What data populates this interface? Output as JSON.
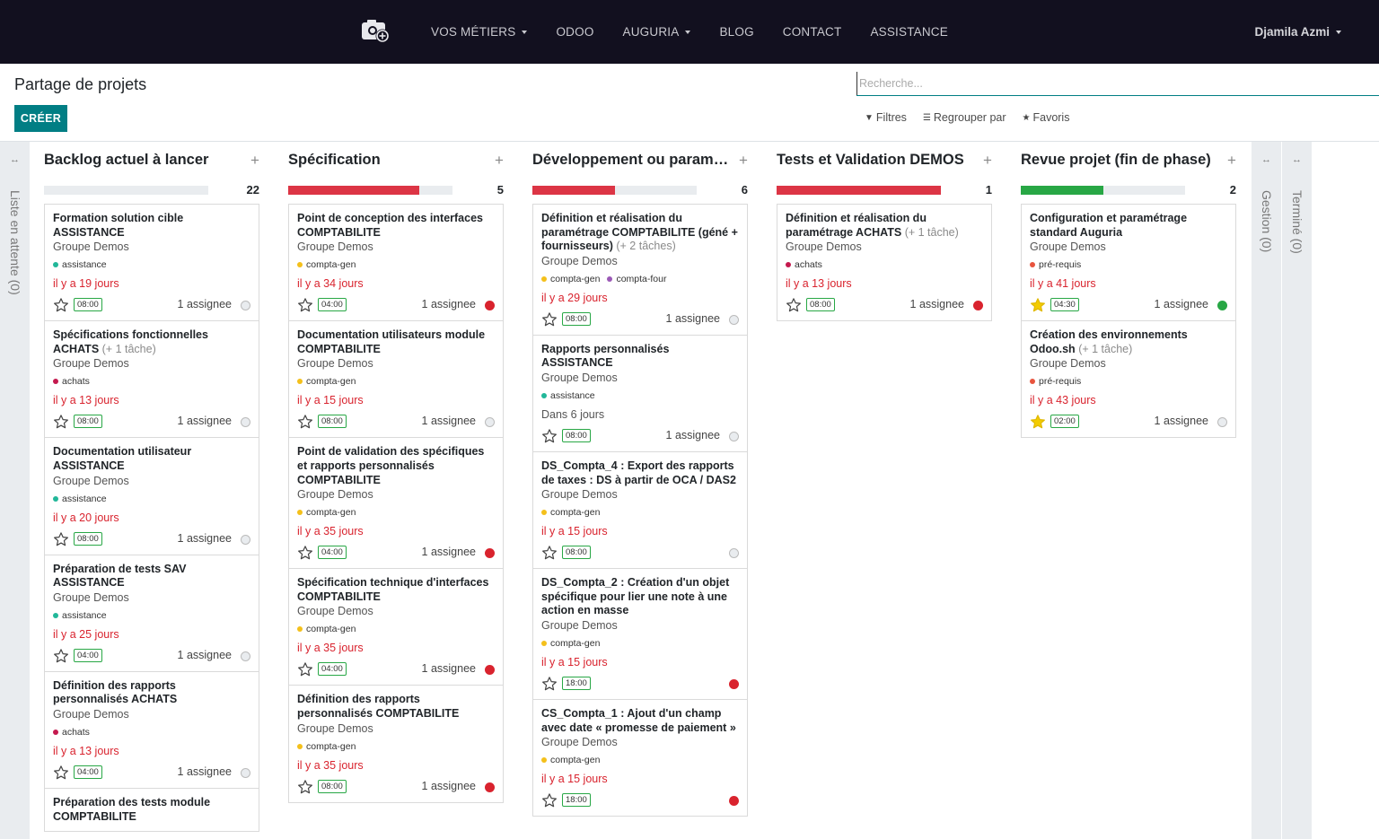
{
  "nav": {
    "menu": [
      {
        "label": "VOS MÉTIERS",
        "dropdown": true
      },
      {
        "label": "ODOO",
        "dropdown": false
      },
      {
        "label": "AUGURIA",
        "dropdown": true
      },
      {
        "label": "BLOG",
        "dropdown": false
      },
      {
        "label": "CONTACT",
        "dropdown": false
      },
      {
        "label": "ASSISTANCE",
        "dropdown": false
      }
    ],
    "user": "Djamila Azmi",
    "logo_icon": "camera-plus-icon"
  },
  "control": {
    "title": "Partage de projets",
    "create_label": "CRÉER",
    "search_placeholder": "Recherche...",
    "filters_label": "Filtres",
    "groupby_label": "Regrouper par",
    "favorites_label": "Favoris"
  },
  "colors": {
    "accent": "#017e84",
    "danger": "#dc3545",
    "success": "#28a745",
    "navbar": "#12101f"
  },
  "folded_left": {
    "label": "Liste en attente (0)"
  },
  "folded_right": [
    {
      "label": "Gestion (0)"
    },
    {
      "label": "Terminé (0)"
    }
  ],
  "columns": [
    {
      "title": "Backlog actuel à lancer",
      "count": "22",
      "progress": {
        "red": 0,
        "green": 0
      },
      "cards": [
        {
          "title": "Formation solution cible ASSISTANCE",
          "subtasks": "",
          "project": "Groupe Demos",
          "tags": [
            {
              "name": "assistance",
              "color": "#21b799"
            }
          ],
          "deadline": "il y a 19 jours",
          "late": true,
          "starred": false,
          "time": "08:00",
          "assignee": "1 assignee",
          "state": "normal"
        },
        {
          "title": "Spécifications fonctionnelles ACHATS",
          "subtasks": "(+ 1 tâche)",
          "project": "Groupe Demos",
          "tags": [
            {
              "name": "achats",
              "color": "#c4194e"
            }
          ],
          "deadline": "il y a 13 jours",
          "late": true,
          "starred": false,
          "time": "08:00",
          "assignee": "1 assignee",
          "state": "normal"
        },
        {
          "title": "Documentation utilisateur ASSISTANCE",
          "subtasks": "",
          "project": "Groupe Demos",
          "tags": [
            {
              "name": "assistance",
              "color": "#21b799"
            }
          ],
          "deadline": "il y a 20 jours",
          "late": true,
          "starred": false,
          "time": "08:00",
          "assignee": "1 assignee",
          "state": "normal"
        },
        {
          "title": "Préparation de tests SAV ASSISTANCE",
          "subtasks": "",
          "project": "Groupe Demos",
          "tags": [
            {
              "name": "assistance",
              "color": "#21b799"
            }
          ],
          "deadline": "il y a 25 jours",
          "late": true,
          "starred": false,
          "time": "04:00",
          "assignee": "1 assignee",
          "state": "normal"
        },
        {
          "title": "Définition des rapports personnalisés ACHATS",
          "subtasks": "",
          "project": "Groupe Demos",
          "tags": [
            {
              "name": "achats",
              "color": "#c4194e"
            }
          ],
          "deadline": "il y a 13 jours",
          "late": true,
          "starred": false,
          "time": "04:00",
          "assignee": "1 assignee",
          "state": "normal"
        },
        {
          "title": "Préparation des tests module COMPTABILITE",
          "subtasks": "",
          "project": "",
          "tags": [],
          "deadline": "",
          "late": false,
          "starred": false,
          "time": "",
          "assignee": "",
          "state": ""
        }
      ]
    },
    {
      "title": "Spécification",
      "count": "5",
      "progress": {
        "red": 0.8,
        "green": 0
      },
      "cards": [
        {
          "title": "Point de conception des interfaces COMPTABILITE",
          "subtasks": "",
          "project": "Groupe Demos",
          "tags": [
            {
              "name": "compta-gen",
              "color": "#f4c01b"
            }
          ],
          "deadline": "il y a 34 jours",
          "late": true,
          "starred": false,
          "time": "04:00",
          "assignee": "1 assignee",
          "state": "blocked"
        },
        {
          "title": "Documentation utilisateurs module COMPTABILITE",
          "subtasks": "",
          "project": "Groupe Demos",
          "tags": [
            {
              "name": "compta-gen",
              "color": "#f4c01b"
            }
          ],
          "deadline": "il y a 15 jours",
          "late": true,
          "starred": false,
          "time": "08:00",
          "assignee": "1 assignee",
          "state": "normal"
        },
        {
          "title": "Point de validation des spécifiques et rapports personnalisés COMPTABILITE",
          "subtasks": "",
          "project": "Groupe Demos",
          "tags": [
            {
              "name": "compta-gen",
              "color": "#f4c01b"
            }
          ],
          "deadline": "il y a 35 jours",
          "late": true,
          "starred": false,
          "time": "04:00",
          "assignee": "1 assignee",
          "state": "blocked"
        },
        {
          "title": "Spécification technique d'interfaces COMPTABILITE",
          "subtasks": "",
          "project": "Groupe Demos",
          "tags": [
            {
              "name": "compta-gen",
              "color": "#f4c01b"
            }
          ],
          "deadline": "il y a 35 jours",
          "late": true,
          "starred": false,
          "time": "04:00",
          "assignee": "1 assignee",
          "state": "blocked"
        },
        {
          "title": "Définition des rapports personnalisés COMPTABILITE",
          "subtasks": "",
          "project": "Groupe Demos",
          "tags": [
            {
              "name": "compta-gen",
              "color": "#f4c01b"
            }
          ],
          "deadline": "il y a 35 jours",
          "late": true,
          "starred": false,
          "time": "08:00",
          "assignee": "1 assignee",
          "state": "blocked"
        }
      ]
    },
    {
      "title": "Développement ou paramétrage",
      "count": "6",
      "progress": {
        "red": 0.5,
        "green": 0
      },
      "cards": [
        {
          "title": "Définition et réalisation du paramétrage COMPTABILITE (géné + fournisseurs)",
          "subtasks": "(+ 2 tâches)",
          "project": "Groupe Demos",
          "tags": [
            {
              "name": "compta-gen",
              "color": "#f4c01b"
            },
            {
              "name": "compta-four",
              "color": "#9b59b6"
            }
          ],
          "deadline": "il y a 29 jours",
          "late": true,
          "starred": false,
          "time": "08:00",
          "assignee": "1 assignee",
          "state": "normal"
        },
        {
          "title": "Rapports personnalisés ASSISTANCE",
          "subtasks": "",
          "project": "Groupe Demos",
          "tags": [
            {
              "name": "assistance",
              "color": "#21b799"
            }
          ],
          "deadline": "Dans 6 jours",
          "late": false,
          "starred": false,
          "time": "08:00",
          "assignee": "1 assignee",
          "state": "normal"
        },
        {
          "title": "DS_Compta_4 : Export des rapports de taxes : DS à partir de OCA / DAS2",
          "subtasks": "",
          "project": "Groupe Demos",
          "tags": [
            {
              "name": "compta-gen",
              "color": "#f4c01b"
            }
          ],
          "deadline": "il y a 15 jours",
          "late": true,
          "starred": false,
          "time": "08:00",
          "assignee": "",
          "state": "normal"
        },
        {
          "title": "DS_Compta_2 : Création d'un objet spécifique pour lier une note à une action en masse",
          "subtasks": "",
          "project": "Groupe Demos",
          "tags": [
            {
              "name": "compta-gen",
              "color": "#f4c01b"
            }
          ],
          "deadline": "il y a 15 jours",
          "late": true,
          "starred": false,
          "time": "18:00",
          "assignee": "",
          "state": "blocked"
        },
        {
          "title": "CS_Compta_1 : Ajout d'un champ avec date « promesse de paiement »",
          "subtasks": "",
          "project": "Groupe Demos",
          "tags": [
            {
              "name": "compta-gen",
              "color": "#f4c01b"
            }
          ],
          "deadline": "il y a 15 jours",
          "late": true,
          "starred": false,
          "time": "18:00",
          "assignee": "",
          "state": "blocked"
        }
      ]
    },
    {
      "title": "Tests et Validation DEMOS",
      "count": "1",
      "progress": {
        "red": 1.0,
        "green": 0
      },
      "cards": [
        {
          "title": "Définition et réalisation du paramétrage ACHATS",
          "subtasks": "(+ 1 tâche)",
          "project": "Groupe Demos",
          "tags": [
            {
              "name": "achats",
              "color": "#c4194e"
            }
          ],
          "deadline": "il y a 13 jours",
          "late": true,
          "starred": false,
          "time": "08:00",
          "assignee": "1 assignee",
          "state": "blocked"
        }
      ]
    },
    {
      "title": "Revue projet (fin de phase)",
      "count": "2",
      "progress": {
        "red": 0,
        "green": 0.5
      },
      "cards": [
        {
          "title": "Configuration et paramétrage standard Auguria",
          "subtasks": "",
          "project": "Groupe Demos",
          "tags": [
            {
              "name": "pré-requis",
              "color": "#e8543e"
            }
          ],
          "deadline": "il y a 41 jours",
          "late": true,
          "starred": true,
          "time": "04:30",
          "assignee": "1 assignee",
          "state": "done"
        },
        {
          "title": "Création des environnements Odoo.sh",
          "subtasks": "(+ 1 tâche)",
          "project": "Groupe Demos",
          "tags": [
            {
              "name": "pré-requis",
              "color": "#e8543e"
            }
          ],
          "deadline": "il y a 43 jours",
          "late": true,
          "starred": true,
          "time": "02:00",
          "assignee": "1 assignee",
          "state": "normal"
        }
      ]
    }
  ]
}
